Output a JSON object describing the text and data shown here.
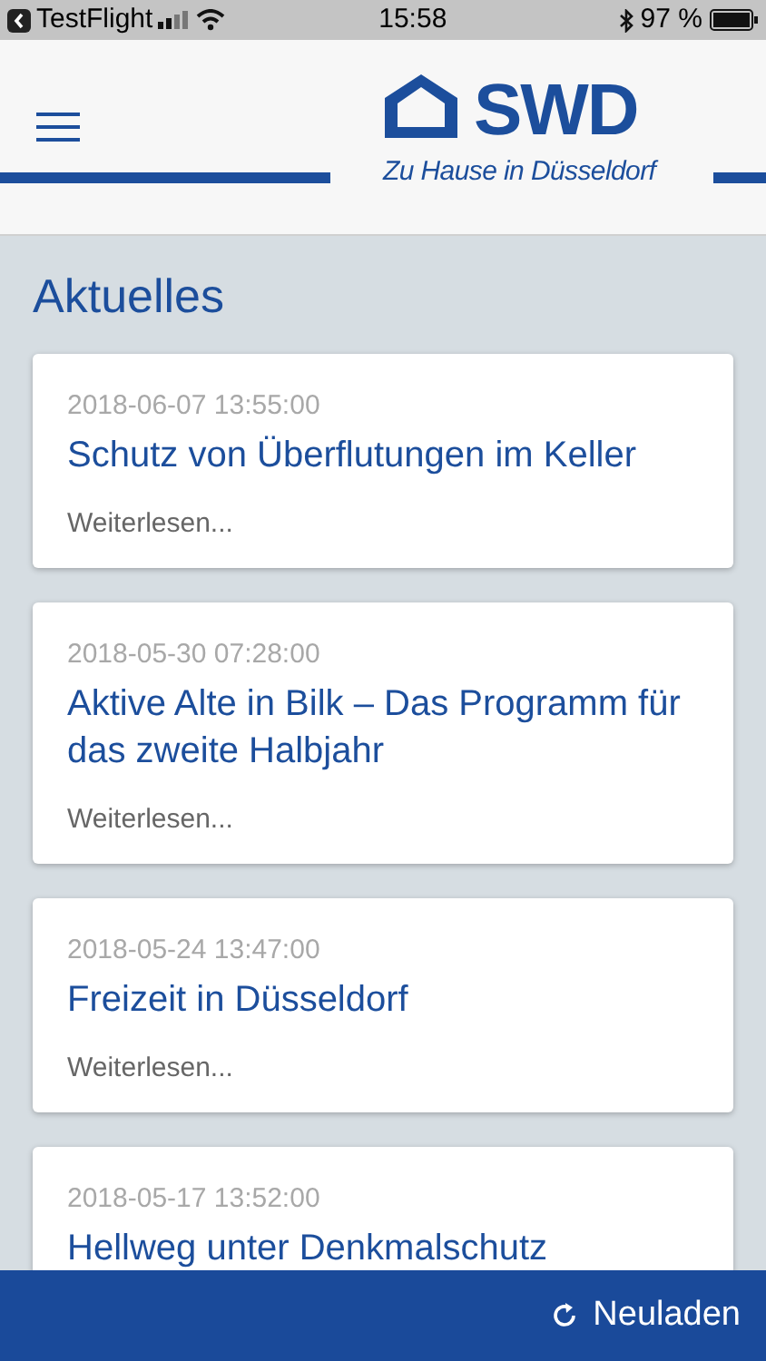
{
  "status_bar": {
    "back_app": "TestFlight",
    "time": "15:58",
    "battery": "97 %"
  },
  "header": {
    "logo_text": "SWD",
    "slogan": "Zu Hause in Düsseldorf"
  },
  "page_title": "Aktuelles",
  "articles": [
    {
      "date": "2018-06-07 13:55:00",
      "title": "Schutz von Überflutungen im Keller",
      "link": "Weiterlesen..."
    },
    {
      "date": "2018-05-30 07:28:00",
      "title": "Aktive Alte in Bilk – Das Programm für das zweite Halbjahr",
      "link": "Weiterlesen..."
    },
    {
      "date": "2018-05-24 13:47:00",
      "title": "Freizeit in Düsseldorf",
      "link": "Weiterlesen..."
    },
    {
      "date": "2018-05-17 13:52:00",
      "title": "Hellweg unter Denkmalschutz"
    }
  ],
  "bottom_bar": {
    "reload_label": "Neuladen"
  }
}
